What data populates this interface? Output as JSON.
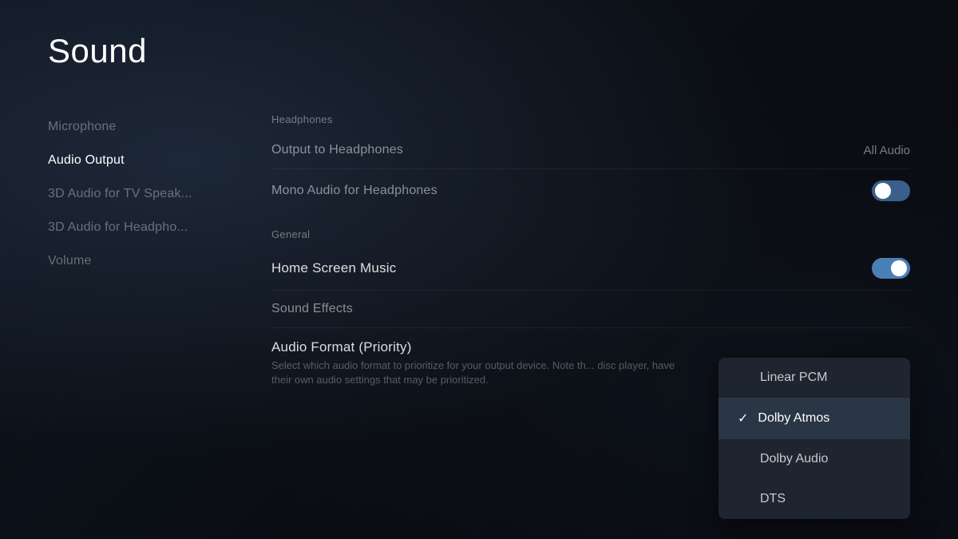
{
  "page": {
    "title": "Sound"
  },
  "sidebar": {
    "items": [
      {
        "id": "microphone",
        "label": "Microphone",
        "active": false
      },
      {
        "id": "audio-output",
        "label": "Audio Output",
        "active": true
      },
      {
        "id": "3d-audio-tv",
        "label": "3D Audio for TV Speak...",
        "active": false
      },
      {
        "id": "3d-audio-headphones",
        "label": "3D Audio for Headpho...",
        "active": false
      },
      {
        "id": "volume",
        "label": "Volume",
        "active": false
      }
    ]
  },
  "main": {
    "sections": [
      {
        "id": "headphones",
        "label": "Headphones",
        "settings": [
          {
            "id": "output-to-headphones",
            "label": "Output to Headphones",
            "value": "All Audio",
            "type": "value"
          },
          {
            "id": "mono-audio-headphones",
            "label": "Mono Audio for Headphones",
            "value": "",
            "type": "toggle",
            "enabled": false
          }
        ]
      },
      {
        "id": "general",
        "label": "General",
        "settings": [
          {
            "id": "home-screen-music",
            "label": "Home Screen Music",
            "value": "",
            "type": "toggle",
            "enabled": true
          },
          {
            "id": "sound-effects",
            "label": "Sound Effects",
            "value": "",
            "type": "none"
          },
          {
            "id": "audio-format-priority",
            "label": "Audio Format (Priority)",
            "value": "",
            "type": "none",
            "description": "Select which audio format to prioritize for your output device. Note th... disc player, have their own audio settings that may be prioritized."
          }
        ]
      }
    ],
    "dropdown": {
      "items": [
        {
          "id": "linear-pcm",
          "label": "Linear PCM",
          "selected": false
        },
        {
          "id": "dolby-atmos",
          "label": "Dolby Atmos",
          "selected": true
        },
        {
          "id": "dolby-audio",
          "label": "Dolby Audio",
          "selected": false
        },
        {
          "id": "dts",
          "label": "DTS",
          "selected": false
        }
      ]
    }
  }
}
